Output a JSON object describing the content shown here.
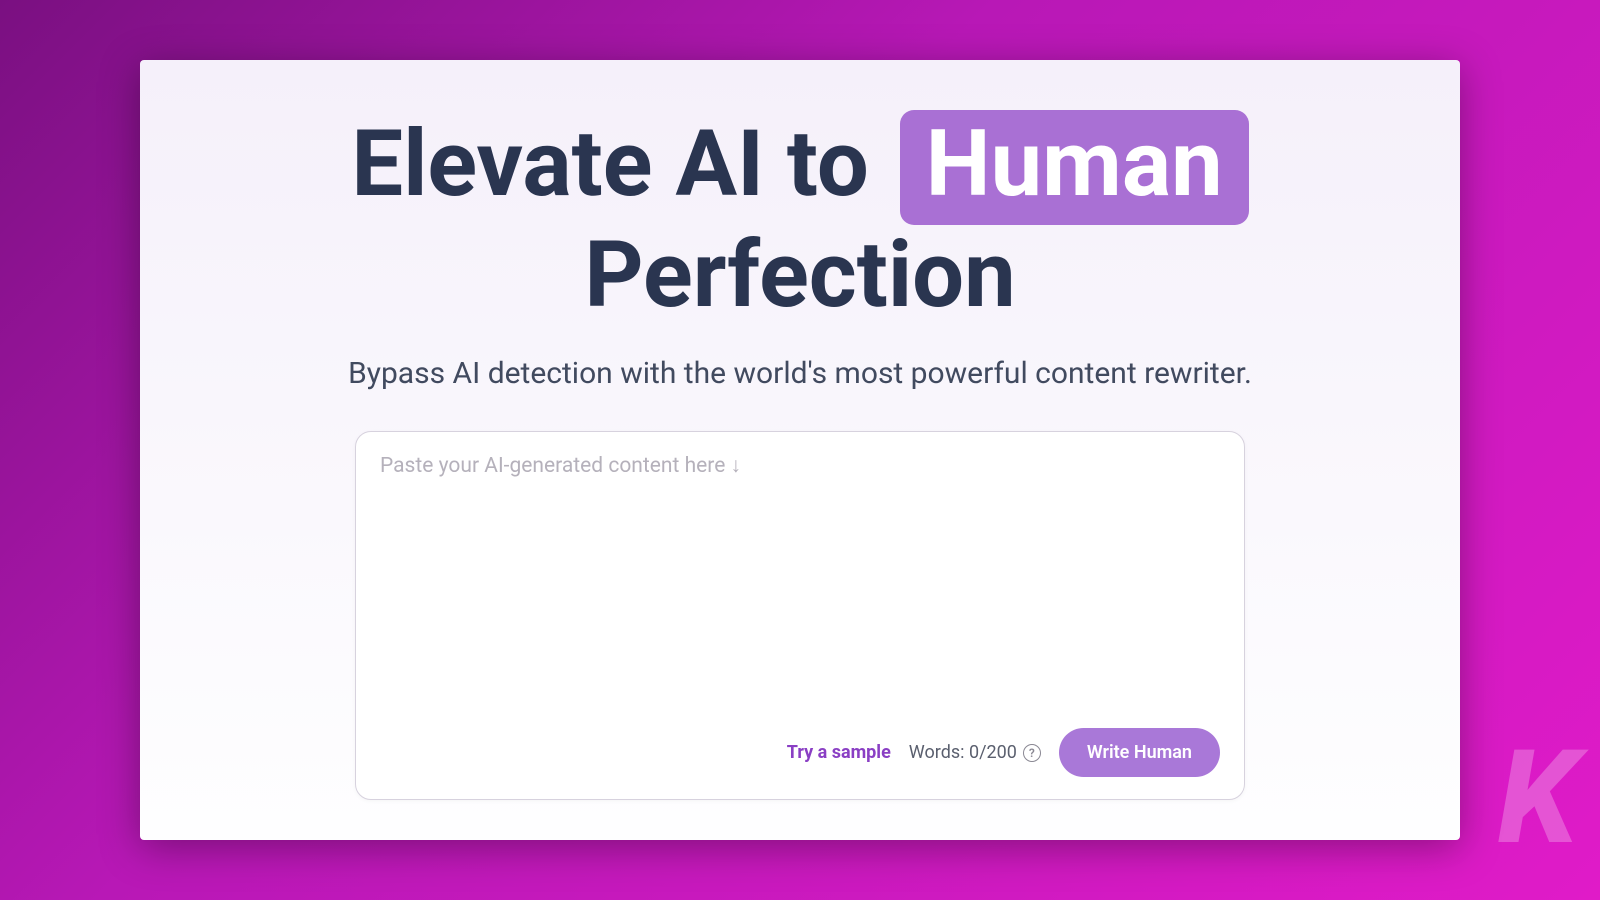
{
  "heading": {
    "part1": "Elevate AI to ",
    "highlight": "Human",
    "part2": "Perfection"
  },
  "subheading": "Bypass AI detection with the world's most powerful content rewriter.",
  "editor": {
    "placeholder": "Paste your AI-generated content here ↓",
    "try_sample_label": "Try a sample",
    "word_count_label": "Words: 0/200",
    "help_icon": "?",
    "write_button_label": "Write Human"
  },
  "watermark": "K"
}
